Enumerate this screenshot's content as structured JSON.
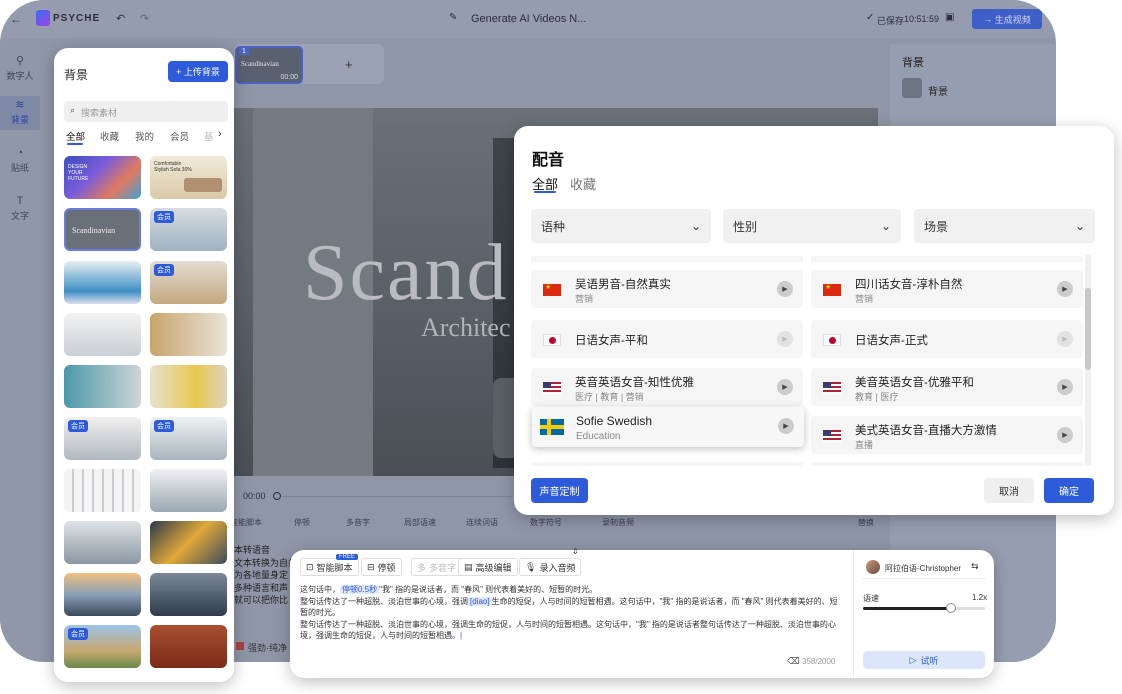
{
  "app": {
    "logo_text": "PSYCHE",
    "doc_title": "Generate AI Videos N...",
    "saved_label": "已保存",
    "saved_time": "10:51:59",
    "generate_label": "生成视频"
  },
  "nav": {
    "items": [
      {
        "label": "数字人",
        "icon": "person-icon"
      },
      {
        "label": "背景",
        "icon": "background-icon"
      },
      {
        "label": "贴纸",
        "icon": "sticker-icon"
      },
      {
        "label": "文字",
        "icon": "text-icon"
      }
    ]
  },
  "timeline": {
    "scene_index": "1",
    "scene_time": "00:00",
    "scene_thumb_text": "Scandinavian",
    "add_label": "+"
  },
  "stage": {
    "big_text": "Scand",
    "sub_text": "Architec"
  },
  "right_panel": {
    "title": "背景",
    "item_label": "背景"
  },
  "player": {
    "time": "00:00"
  },
  "bg_tools": {
    "items": [
      "智能脚本",
      "停顿",
      "多音字",
      "局部语速",
      "连续词语",
      "数字符号",
      "录制音频"
    ],
    "replace_label": "替换"
  },
  "behind_text": {
    "lines": [
      "本转语音",
      "文本转换为自然",
      "为各地量身定",
      "多种语言和声",
      "就可以把你比"
    ],
    "voice_tag": "强劲·纯净"
  },
  "bg_panel": {
    "title": "背景",
    "upload_label": "+ 上传背景",
    "search_placeholder": "搜索素材",
    "tabs": [
      "全部",
      "收藏",
      "我的",
      "会员",
      "基"
    ],
    "member_badge": "会员",
    "thumbs": [
      {
        "label": "DESIGN YOUR FUTURE"
      },
      {
        "label": "Comfortable Stylish Sofa 30%"
      },
      {
        "label": "Scandinavian"
      },
      {
        "label": "会员"
      }
    ]
  },
  "dubbing": {
    "title": "配音",
    "tabs": [
      "全部",
      "收藏"
    ],
    "filters": [
      "语种",
      "性别",
      "场景"
    ],
    "voices": [
      {
        "name": "吴语男音-自然真实",
        "tags": "营销",
        "flag": "cn"
      },
      {
        "name": "四川话女音-淳朴自然",
        "tags": "营销",
        "flag": "cn"
      },
      {
        "name": "日语女声-平和",
        "tags": "",
        "flag": "jp"
      },
      {
        "name": "日语女声-正式",
        "tags": "",
        "flag": "jp"
      },
      {
        "name": "英音英语女音-知性优雅",
        "tags": "医疗 | 教育 | 营销",
        "flag": "us"
      },
      {
        "name": "美音英语女音-优雅平和",
        "tags": "教育 | 医疗",
        "flag": "us"
      },
      {
        "name": "Sofie Swedish",
        "tags": "Education",
        "flag": "se"
      },
      {
        "name": "美式英语女音-直播大方激情",
        "tags": "直播",
        "flag": "us"
      }
    ],
    "custom_label": "声音定制",
    "cancel_label": "取消",
    "confirm_label": "确定"
  },
  "script": {
    "tools": [
      "智能脚本",
      "停顿",
      "多音字",
      "高级编辑",
      "录入音频"
    ],
    "free_badge": "FREE",
    "pause_tag": "停顿0.5秒",
    "phonetic_tag": "[diao]",
    "seg1": "这句话中，",
    "seg2": "\"我\" 指的是说话者，而 \"春风\" 则代表着美好的、短暂的时光。",
    "seg3": "整句话传达了一种超脱、淡泊世事的心境，强调",
    "seg4": "生命的短促，人与时间的短暂相遇。这句话中，\"我\" 指的是说话者，而 \"春风\" 则代表着美好的、短暂的时光。",
    "seg5": "整句话传达了一种超脱、淡泊世事的心境，强调生命的短促，人与时间的短暂相遇。这句话中，\"我\" 指的是说话者整句话传达了一种超脱、淡泊世事的心境，强调生命的短促，人与时间的短暂相遇。",
    "counter": "358/2000",
    "voice_name": "阿拉伯语-Christopher",
    "speed_label": "语速",
    "speed_value": "1.2x",
    "speed_fraction": 0.72,
    "preview_label": "试听"
  }
}
